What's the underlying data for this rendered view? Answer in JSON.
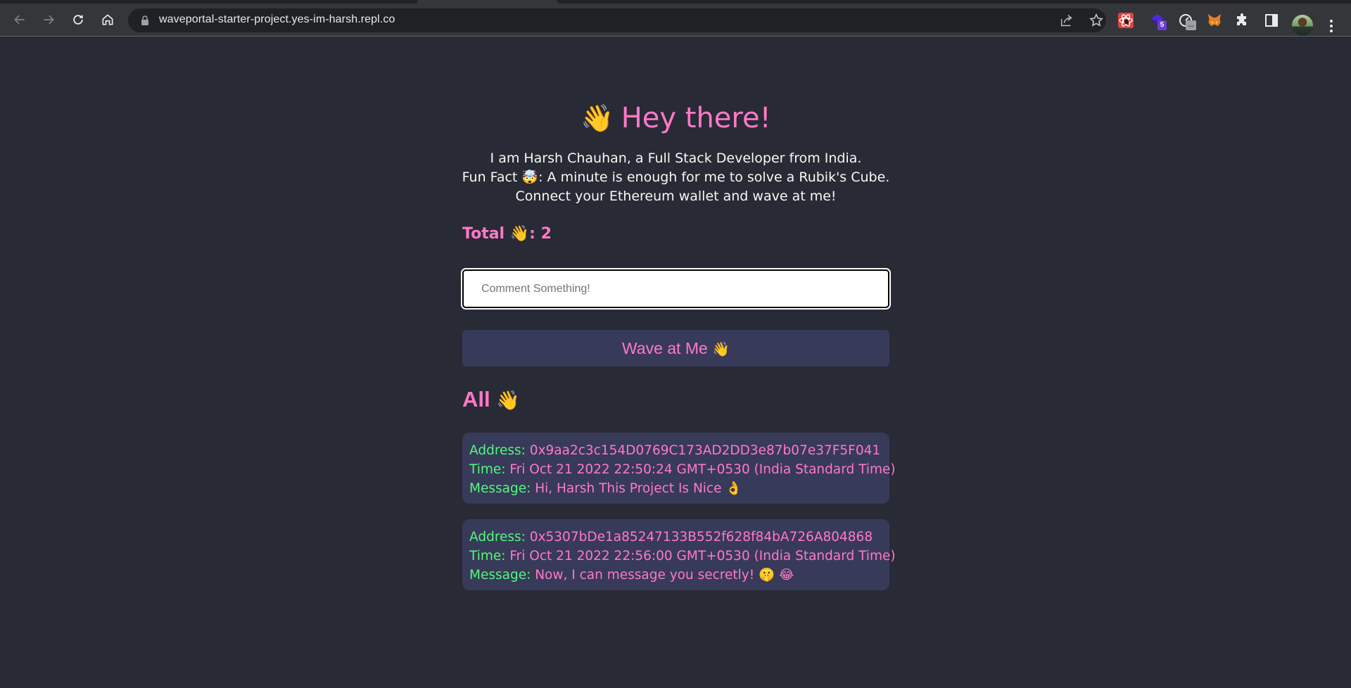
{
  "browser": {
    "url": "waveportal-starter-project.yes-im-harsh.repl.co",
    "extensions": [
      {
        "name": "react-developer-tools",
        "badge": ""
      },
      {
        "name": "stack-extension",
        "badge": "5"
      },
      {
        "name": "speed-extension",
        "badge": "..."
      },
      {
        "name": "metamask",
        "badge": ""
      }
    ]
  },
  "page": {
    "header_emoji": "👋",
    "header_title": "Hey there!",
    "bio": {
      "line1": "I am Harsh Chauhan, a Full Stack Developer from India.",
      "line2_prefix": "Fun Fact ",
      "line2_emoji": "🤯",
      "line2_suffix": ": A minute is enough for me to solve a Rubik's Cube.",
      "line3": "Connect your Ethereum wallet and wave at me!"
    },
    "total": {
      "label": "Total ",
      "emoji": "👋",
      "separator": ": ",
      "count": "2"
    },
    "comment_input": {
      "placeholder": "Comment Something!",
      "value": ""
    },
    "wave_button": {
      "label": "Wave at Me ",
      "emoji": "👋"
    },
    "all_waves": {
      "title": "All ",
      "emoji": "👋"
    },
    "labels": {
      "address": "Address: ",
      "time": "Time: ",
      "message": "Message: "
    },
    "waves": [
      {
        "address": "0x9aa2c3c154D0769C173AD2DD3e87b07e37F5F041",
        "time": "Fri Oct 21 2022 22:50:24 GMT+0530 (India Standard Time)",
        "message": "Hi, Harsh This Project Is Nice 👌"
      },
      {
        "address": "0x5307bDe1a85247133B552f628f84bA726A804868",
        "time": "Fri Oct 21 2022 22:56:00 GMT+0530 (India Standard Time)",
        "message": "Now, I can message you secretly! 🤫 😂"
      }
    ]
  },
  "colors": {
    "background": "#282a36",
    "accent_pink": "#ff79c6",
    "label_green": "#50fa7b",
    "card_bg": "#383a59",
    "text": "#f8f8f2"
  }
}
